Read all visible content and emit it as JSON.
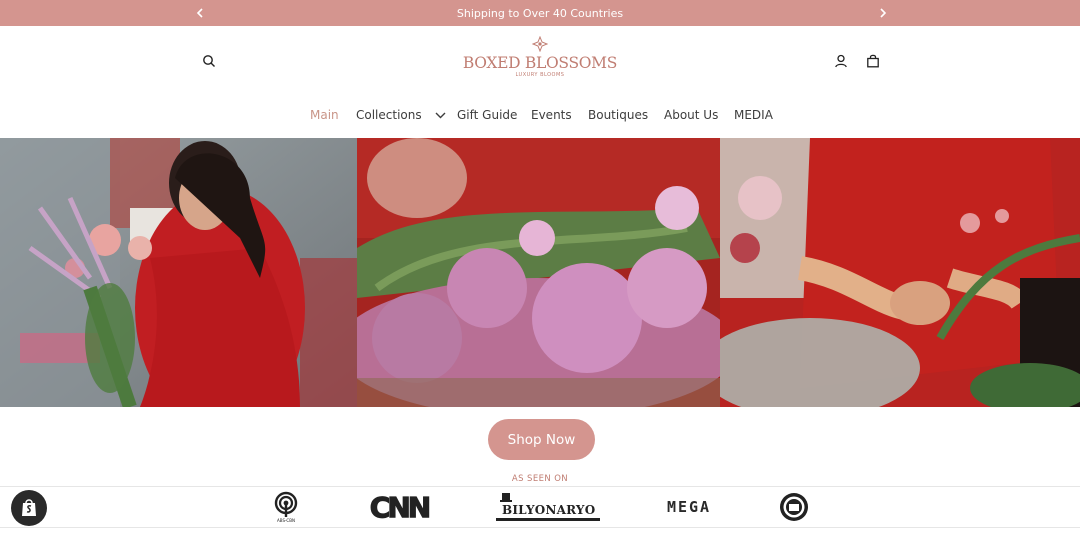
{
  "announcement": {
    "text": "Shipping to Over 40 Countries",
    "prev_icon": "chevron-left-icon",
    "next_icon": "chevron-right-icon"
  },
  "brand": {
    "name": "BOXED BLOSSOMS",
    "tagline": "LUXURY BLOOMS"
  },
  "header": {
    "search_icon": "search-icon",
    "account_icon": "user-icon",
    "cart_icon": "shopping-bag-icon"
  },
  "nav": {
    "items": [
      {
        "label": "Main",
        "active": true
      },
      {
        "label": "Collections",
        "has_dropdown": true
      },
      {
        "label": "Gift Guide"
      },
      {
        "label": "Events"
      },
      {
        "label": "Boutiques"
      },
      {
        "label": "About Us"
      },
      {
        "label": "MEDIA"
      }
    ]
  },
  "hero": {
    "cta_label": "Shop Now"
  },
  "press": {
    "heading": "AS SEEN ON",
    "logos": [
      {
        "name": "abs-cbn-logo",
        "text": "ABS-CBN"
      },
      {
        "name": "cnn-logo",
        "text": "CNN"
      },
      {
        "name": "bilyonaryo-logo",
        "text": "BILYONARYO"
      },
      {
        "name": "mega-logo",
        "text": "MEGA"
      },
      {
        "name": "seal-logo"
      }
    ]
  },
  "colors": {
    "accent": "#d4958f",
    "brand_text": "#c07d72",
    "nav_active": "#c99588"
  }
}
